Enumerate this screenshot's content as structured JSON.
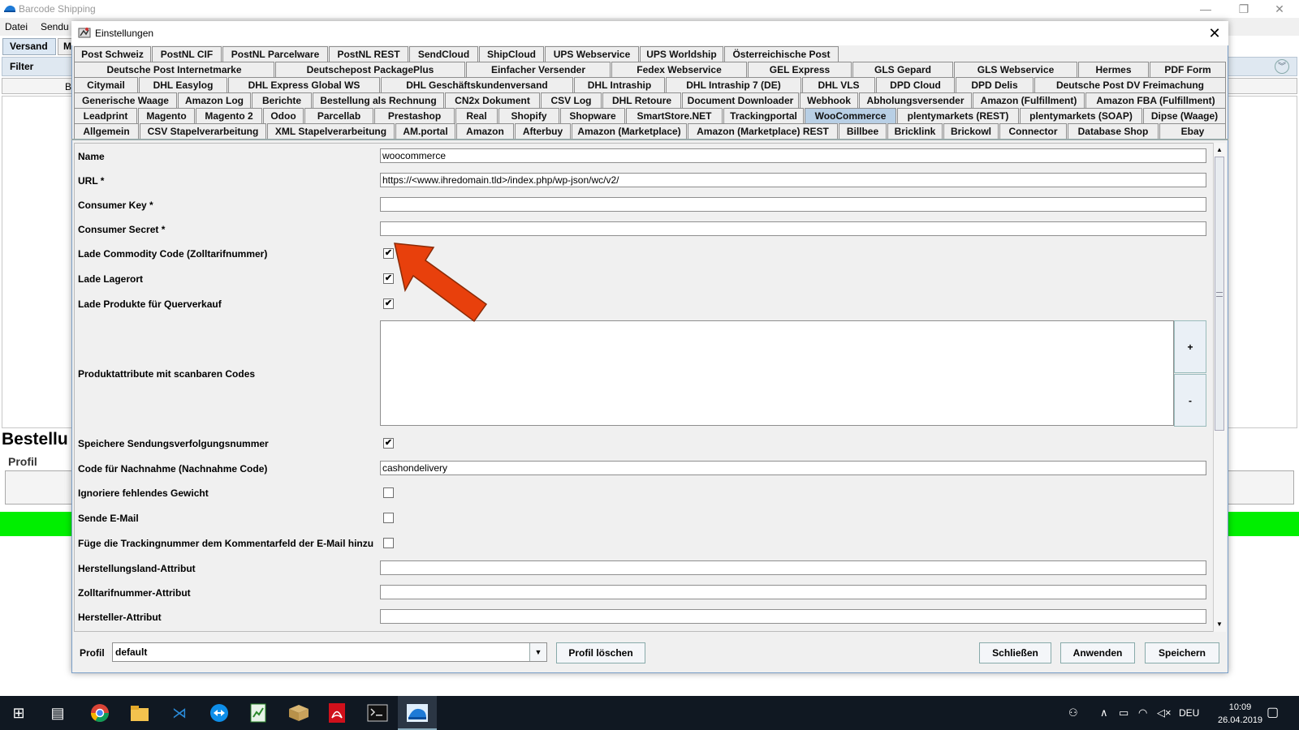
{
  "background_app": {
    "title": "Barcode Shipping",
    "menus": [
      "Datei",
      "Sendu"
    ],
    "tab_versand": "Versand",
    "tab_m": "M",
    "filter_label": "Filter",
    "col_b": "B",
    "bestellung_label": "Bestellu",
    "profil_label": "Profil"
  },
  "dialog": {
    "title": "Einstellungen",
    "tab_rows": [
      [
        "Post Schweiz",
        "PostNL CIF",
        "PostNL Parcelware",
        "PostNL REST",
        "SendCloud",
        "ShipCloud",
        "UPS Webservice",
        "UPS Worldship",
        "Österreichische Post"
      ],
      [
        "Deutsche Post Internetmarke",
        "Deutschepost PackagePlus",
        "Einfacher Versender",
        "Fedex Webservice",
        "GEL Express",
        "GLS Gepard",
        "GLS Webservice",
        "Hermes",
        "PDF Form"
      ],
      [
        "Citymail",
        "DHL Easylog",
        "DHL Express Global WS",
        "DHL Geschäftskundenversand",
        "DHL Intraship",
        "DHL Intraship 7 (DE)",
        "DHL VLS",
        "DPD Cloud",
        "DPD Delis",
        "Deutsche Post DV Freimachung"
      ],
      [
        "Generische Waage",
        "Amazon Log",
        "Berichte",
        "Bestellung als Rechnung",
        "CN2x Dokument",
        "CSV Log",
        "DHL Retoure",
        "Document Downloader",
        "Webhook",
        "Abholungsversender",
        "Amazon (Fulfillment)",
        "Amazon FBA (Fulfillment)"
      ],
      [
        "Leadprint",
        "Magento",
        "Magento 2",
        "Odoo",
        "Parcellab",
        "Prestashop",
        "Real",
        "Shopify",
        "Shopware",
        "SmartStore.NET",
        "Trackingportal",
        "WooCommerce",
        "plentymarkets (REST)",
        "plentymarkets (SOAP)",
        "Dipse (Waage)"
      ],
      [
        "Allgemein",
        "CSV Stapelverarbeitung",
        "XML Stapelverarbeitung",
        "AM.portal",
        "Amazon",
        "Afterbuy",
        "Amazon (Marketplace)",
        "Amazon (Marketplace) REST",
        "Billbee",
        "Bricklink",
        "Brickowl",
        "Connector",
        "Database Shop",
        "Ebay"
      ]
    ],
    "active_tab": "WooCommerce",
    "form": {
      "name_label": "Name",
      "name_value": "woocommerce",
      "url_label": "URL *",
      "url_value": "https://<www.ihredomain.tld>/index.php/wp-json/wc/v2/",
      "consumer_key_label": "Consumer Key *",
      "consumer_key_value": "",
      "consumer_secret_label": "Consumer Secret *",
      "consumer_secret_value": "",
      "commodity_label": "Lade Commodity Code (Zolltarifnummer)",
      "commodity_checked": true,
      "lagerort_label": "Lade Lagerort",
      "lagerort_checked": true,
      "querverkauf_label": "Lade Produkte für Querverkauf",
      "querverkauf_checked": true,
      "attribute_label": "Produktattribute mit scanbaren Codes",
      "add_label": "+",
      "remove_label": "-",
      "sendungsnummer_label": "Speichere Sendungsverfolgungsnummer",
      "sendungsnummer_checked": true,
      "nachnahme_label": "Code für Nachnahme (Nachnahme Code)",
      "nachnahme_value": "cashondelivery",
      "gewicht_label": "Ignoriere fehlendes Gewicht",
      "gewicht_checked": false,
      "email_label": "Sende E-Mail",
      "email_checked": false,
      "tracking_kommentar_label": "Füge die Trackingnummer dem Kommentarfeld der E-Mail hinzu",
      "tracking_kommentar_checked": false,
      "herstellungsland_label": "Herstellungsland-Attribut",
      "herstellungsland_value": "",
      "zolltarif_label": "Zolltarifnummer-Attribut",
      "zolltarif_value": "",
      "hersteller_label": "Hersteller-Attribut",
      "hersteller_value": ""
    },
    "footer": {
      "profil_label": "Profil",
      "profil_value": "default",
      "delete_profile": "Profil löschen",
      "close": "Schließen",
      "apply": "Anwenden",
      "save": "Speichern"
    }
  },
  "annotation": {
    "arrow_color": "#e8400c"
  },
  "taskbar": {
    "language": "DEU",
    "time": "10:09",
    "date": "26.04.2019",
    "icons": [
      "windows-start-icon",
      "task-view-icon",
      "chrome-icon",
      "file-explorer-icon",
      "vscode-icon",
      "teamviewer-icon",
      "spreadsheet-icon",
      "package-icon",
      "acrobat-icon",
      "terminal-icon",
      "barcode-shipping-icon"
    ]
  }
}
